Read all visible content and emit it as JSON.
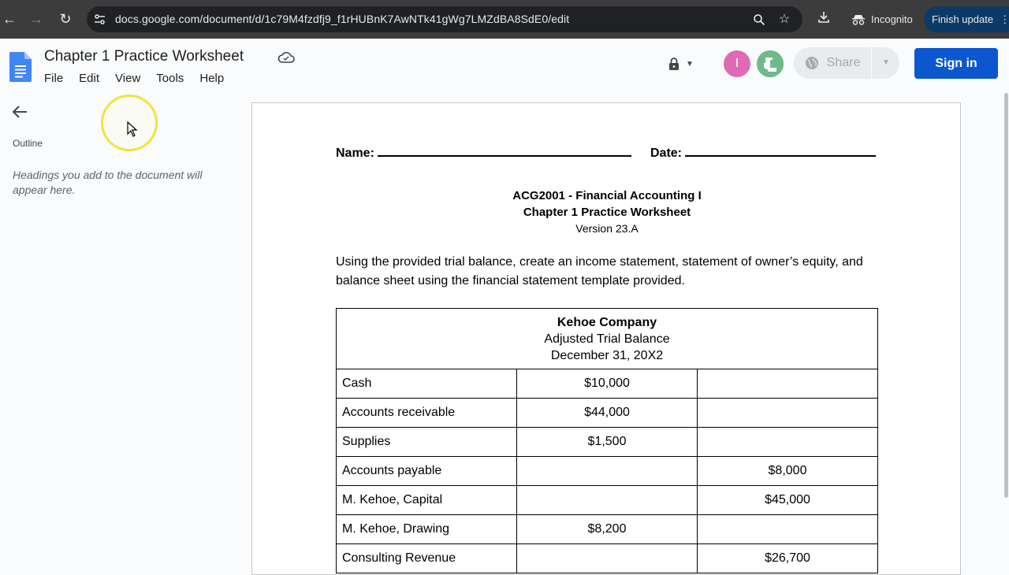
{
  "browser": {
    "url": "docs.google.com/document/d/1c79M4fzdfj9_f1rHUBnK7AwNTk41gWg7LMZdBA8SdE0/edit",
    "incognito_label": "Incognito",
    "finish_update_label": "Finish update"
  },
  "docs": {
    "title": "Chapter 1 Practice Worksheet",
    "menu": [
      "File",
      "Edit",
      "View",
      "Tools",
      "Help"
    ],
    "avatars": [
      {
        "letter": "I",
        "color": "#e06bb4"
      },
      {
        "letter": "",
        "color": "#6fb98a"
      }
    ],
    "share_label": "Share",
    "sign_in_label": "Sign in"
  },
  "outline": {
    "label": "Outline",
    "hint": "Headings you add to the document will appear here."
  },
  "document": {
    "name_label": "Name:",
    "date_label": "Date:",
    "course": "ACG2001 - Financial Accounting I",
    "chapter": "Chapter 1 Practice Worksheet",
    "version": "Version 23.A",
    "instructions": "Using the provided trial balance, create an income statement, statement of owner’s equity, and balance sheet using the financial statement template provided.",
    "table": {
      "company": "Kehoe Company",
      "subtitle": "Adjusted Trial Balance",
      "date": "December 31, 20X2",
      "rows": [
        {
          "account": "Cash",
          "debit": "$10,000",
          "credit": ""
        },
        {
          "account": "Accounts receivable",
          "debit": "$44,000",
          "credit": ""
        },
        {
          "account": "Supplies",
          "debit": "$1,500",
          "credit": ""
        },
        {
          "account": "Accounts payable",
          "debit": "",
          "credit": "$8,000"
        },
        {
          "account": "M. Kehoe, Capital",
          "debit": "",
          "credit": "$45,000"
        },
        {
          "account": "M. Kehoe, Drawing",
          "debit": "$8,200",
          "credit": ""
        },
        {
          "account": "Consulting Revenue",
          "debit": "",
          "credit": "$26,700"
        }
      ]
    }
  }
}
